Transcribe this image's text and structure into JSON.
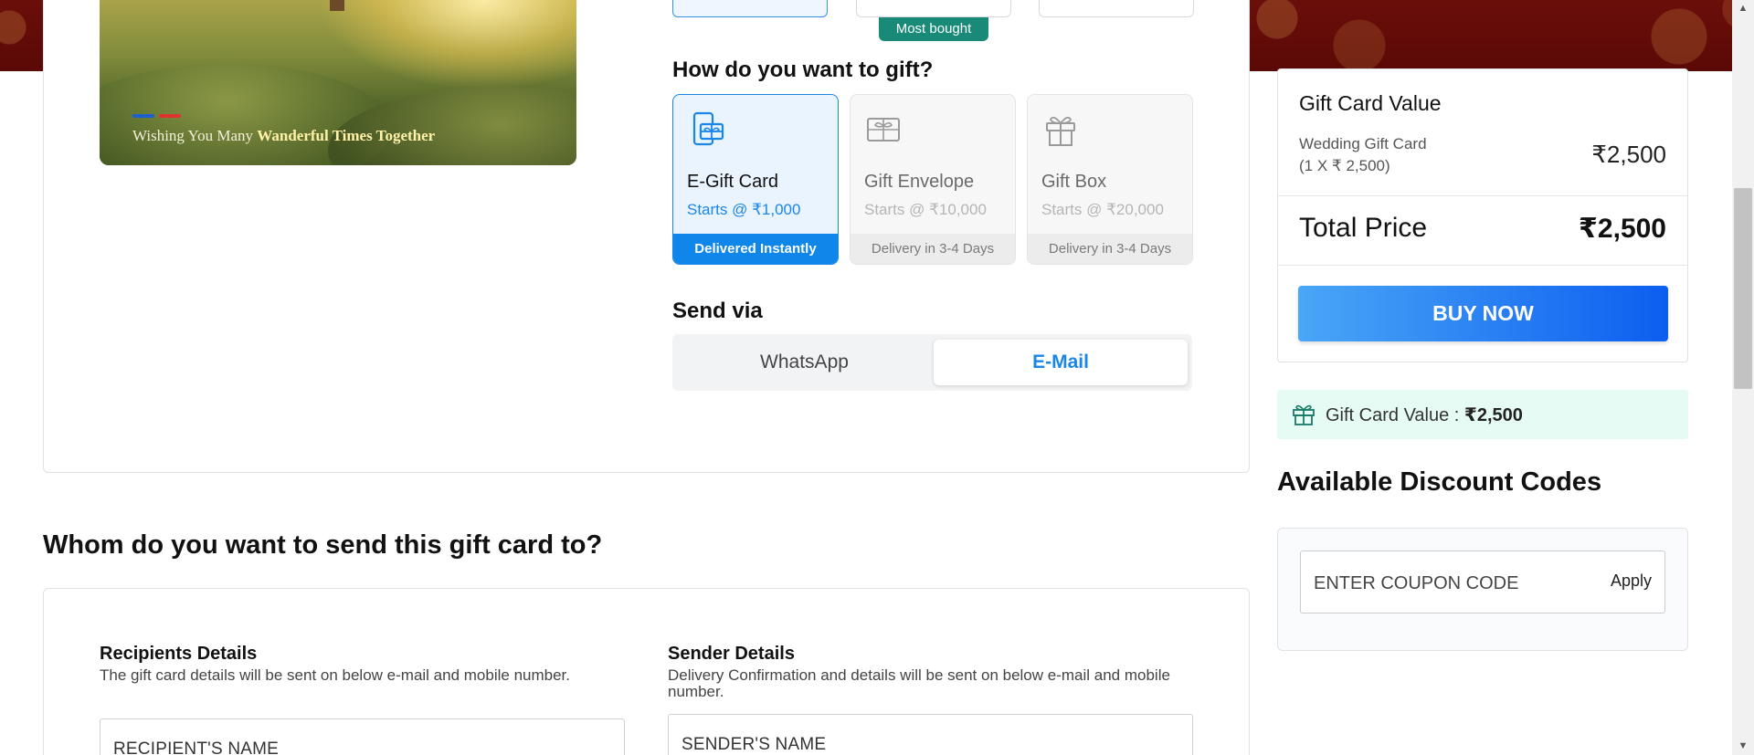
{
  "hero": {
    "caption_prefix": "Wishing You Many ",
    "caption_bold": "Wanderful Times Together"
  },
  "top_strip": {
    "badge": "Most bought"
  },
  "gift_method": {
    "title": "How do you want to gift?",
    "options": [
      {
        "name": "E-Gift Card",
        "price": "Starts @ ₹1,000",
        "footer": "Delivered Instantly",
        "icon": "phone-gift-icon",
        "selected": true
      },
      {
        "name": "Gift Envelope",
        "price": "Starts @ ₹10,000",
        "footer": "Delivery in 3-4 Days",
        "icon": "envelope-gift-icon",
        "selected": false
      },
      {
        "name": "Gift Box",
        "price": "Starts @ ₹20,000",
        "footer": "Delivery in 3-4 Days",
        "icon": "gift-box-icon",
        "selected": false
      }
    ]
  },
  "send_via": {
    "title": "Send via",
    "whatsapp": "WhatsApp",
    "email": "E-Mail",
    "selected": "E-Mail"
  },
  "recipient_section": {
    "title": "Whom do you want to send this gift card to?",
    "recipients": {
      "title": "Recipients Details",
      "desc": "The gift card details will be sent on below e-mail and mobile number.",
      "name_placeholder": "RECIPIENT'S NAME"
    },
    "sender": {
      "title": "Sender Details",
      "desc": "Delivery Confirmation and details will be sent on below e-mail and mobile number.",
      "name_placeholder": "SENDER'S NAME"
    }
  },
  "summary": {
    "heading": "Gift Card Value",
    "item_line1": "Wedding Gift Card",
    "item_line2": "(1 X ₹ 2,500)",
    "item_value": "₹2,500",
    "total_label": "Total Price",
    "total_value": "₹2,500",
    "buy_label": "BUY NOW"
  },
  "gift_value_banner": {
    "label": "Gift Card Value : ",
    "value": "₹2,500"
  },
  "discount": {
    "title": "Available Discount Codes",
    "coupon_placeholder": "ENTER COUPON CODE",
    "apply_label": "Apply"
  },
  "colors": {
    "accent": "#1a86e8",
    "buy_gradient_start": "#4aa6f6",
    "buy_gradient_end": "#0c5ef0",
    "badge": "#1a8a78",
    "banner": "#6b0e0a"
  }
}
